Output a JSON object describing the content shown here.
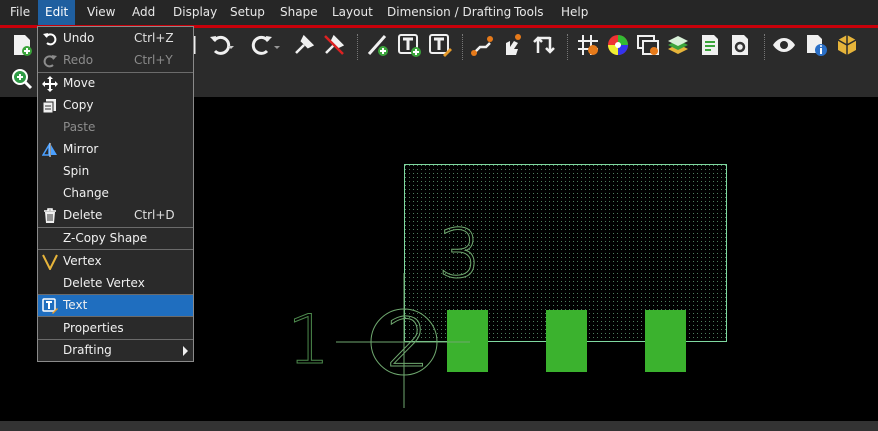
{
  "menubar": {
    "items": [
      "File",
      "Edit",
      "View",
      "Add",
      "Display",
      "Setup",
      "Shape",
      "Layout",
      "Dimension / Drafting",
      "Tools",
      "Help"
    ],
    "active": "Edit"
  },
  "edit_menu": {
    "undo": {
      "label": "Undo",
      "shortcut": "Ctrl+Z"
    },
    "redo": {
      "label": "Redo",
      "shortcut": "Ctrl+Y"
    },
    "move": {
      "label": "Move"
    },
    "copy": {
      "label": "Copy"
    },
    "paste": {
      "label": "Paste"
    },
    "mirror": {
      "label": "Mirror"
    },
    "spin": {
      "label": "Spin"
    },
    "change": {
      "label": "Change"
    },
    "delete": {
      "label": "Delete",
      "shortcut": "Ctrl+D"
    },
    "zcopy": {
      "label": "Z-Copy Shape"
    },
    "vertex": {
      "label": "Vertex"
    },
    "delete_vertex": {
      "label": "Delete Vertex"
    },
    "text": {
      "label": "Text"
    },
    "properties": {
      "label": "Properties"
    },
    "drafting": {
      "label": "Drafting"
    }
  },
  "canvas": {
    "pin_labels": [
      "1",
      "2",
      "3"
    ]
  },
  "colors": {
    "menubar_active": "#1f5fa0",
    "accent_red": "#c8000a",
    "selected_item": "#1f6ebf",
    "pad_green": "#3bb22e",
    "outline_green": "#7fd8a0"
  }
}
